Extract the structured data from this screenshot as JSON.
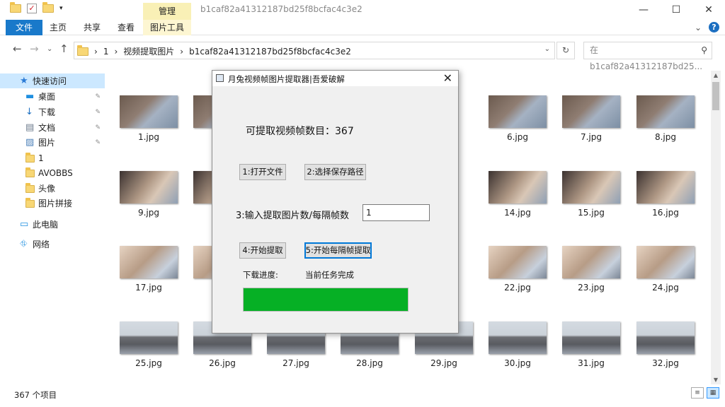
{
  "explorer": {
    "manage_tab": "管理",
    "folder_title": "b1caf82a41312187bd25f8bcfac4c3e2",
    "window_buttons": {
      "minimize": "—",
      "maximize": "☐",
      "close": "✕"
    },
    "ribbon_tabs": [
      "文件",
      "主页",
      "共享",
      "查看",
      "图片工具"
    ],
    "ribbon_right": {
      "chevron": "⌄",
      "help": "?"
    },
    "nav": {
      "back": "←",
      "forward": "→",
      "recent": "⌄",
      "up": "↑"
    },
    "breadcrumbs": [
      "1",
      "视频提取图片",
      "b1caf82a41312187bd25f8bcfac4c3e2"
    ],
    "crumb_sep": "›",
    "refresh": "↻",
    "search_placeholder": "在 b1caf82a41312187bd25...",
    "search_icon": "⚲",
    "sidebar": [
      {
        "label": "快速访问",
        "icon": "star-icon",
        "glyph": "★",
        "color": "#2b7bd6"
      },
      {
        "label": "桌面",
        "icon": "desktop-icon",
        "glyph": "▬",
        "color": "#1f8fe0",
        "pinned": true
      },
      {
        "label": "下载",
        "icon": "download-icon",
        "glyph": "↓",
        "color": "#1c6fc1",
        "pinned": true
      },
      {
        "label": "文档",
        "icon": "document-icon",
        "glyph": "▤",
        "color": "#6d7b8d",
        "pinned": true
      },
      {
        "label": "图片",
        "icon": "pictures-icon",
        "glyph": "▨",
        "color": "#4b7fb8",
        "pinned": true
      },
      {
        "label": "1",
        "icon": "folder-icon"
      },
      {
        "label": "AVOBBS",
        "icon": "folder-icon"
      },
      {
        "label": "头像",
        "icon": "folder-icon"
      },
      {
        "label": "图片拼接",
        "icon": "folder-icon"
      },
      {
        "label": "此电脑",
        "icon": "computer-icon",
        "glyph": "▭",
        "color": "#1f8fe0"
      },
      {
        "label": "网络",
        "icon": "network-icon",
        "glyph": "⛗",
        "color": "#1f8fe0"
      }
    ],
    "pin_glyph": "✎",
    "status_text": "367 个项目",
    "view_buttons": [
      "≡",
      "▦"
    ],
    "thumbnails": [
      {
        "name": "1.jpg",
        "row": 1,
        "col": 0
      },
      {
        "name": "",
        "row": 1,
        "col": 1
      },
      {
        "name": "6.jpg",
        "row": 1,
        "col": 5
      },
      {
        "name": "7.jpg",
        "row": 1,
        "col": 6
      },
      {
        "name": "8.jpg",
        "row": 1,
        "col": 7
      },
      {
        "name": "9.jpg",
        "row": 2,
        "col": 0
      },
      {
        "name": "",
        "row": 2,
        "col": 1
      },
      {
        "name": "14.jpg",
        "row": 2,
        "col": 5
      },
      {
        "name": "15.jpg",
        "row": 2,
        "col": 6
      },
      {
        "name": "16.jpg",
        "row": 2,
        "col": 7
      },
      {
        "name": "17.jpg",
        "row": 3,
        "col": 0
      },
      {
        "name": "",
        "row": 3,
        "col": 1
      },
      {
        "name": "22.jpg",
        "row": 3,
        "col": 5
      },
      {
        "name": "23.jpg",
        "row": 3,
        "col": 6
      },
      {
        "name": "24.jpg",
        "row": 3,
        "col": 7
      },
      {
        "name": "25.jpg",
        "row": 4,
        "col": 0
      },
      {
        "name": "26.jpg",
        "row": 4,
        "col": 1
      },
      {
        "name": "27.jpg",
        "row": 4,
        "col": 2
      },
      {
        "name": "28.jpg",
        "row": 4,
        "col": 3
      },
      {
        "name": "29.jpg",
        "row": 4,
        "col": 4
      },
      {
        "name": "30.jpg",
        "row": 4,
        "col": 5
      },
      {
        "name": "31.jpg",
        "row": 4,
        "col": 6
      },
      {
        "name": "32.jpg",
        "row": 4,
        "col": 7
      }
    ]
  },
  "dialog": {
    "title": "月兔视频帧图片提取器|吾爱破解",
    "close": "✕",
    "frame_count_label": "可提取视频帧数目：367",
    "open_file_button": "1:打开文件",
    "save_path_button": "2:选择保存路径",
    "interval_label": "3:输入提取图片数/每隔帧数",
    "interval_value": "1",
    "start_button": "4:开始提取",
    "start_interval_button": "5:开始每隔帧提取",
    "progress_label": "下载进度:",
    "task_status": "当前任务完成",
    "progress_fraction": 1.0,
    "progress_color": "#06b025"
  }
}
